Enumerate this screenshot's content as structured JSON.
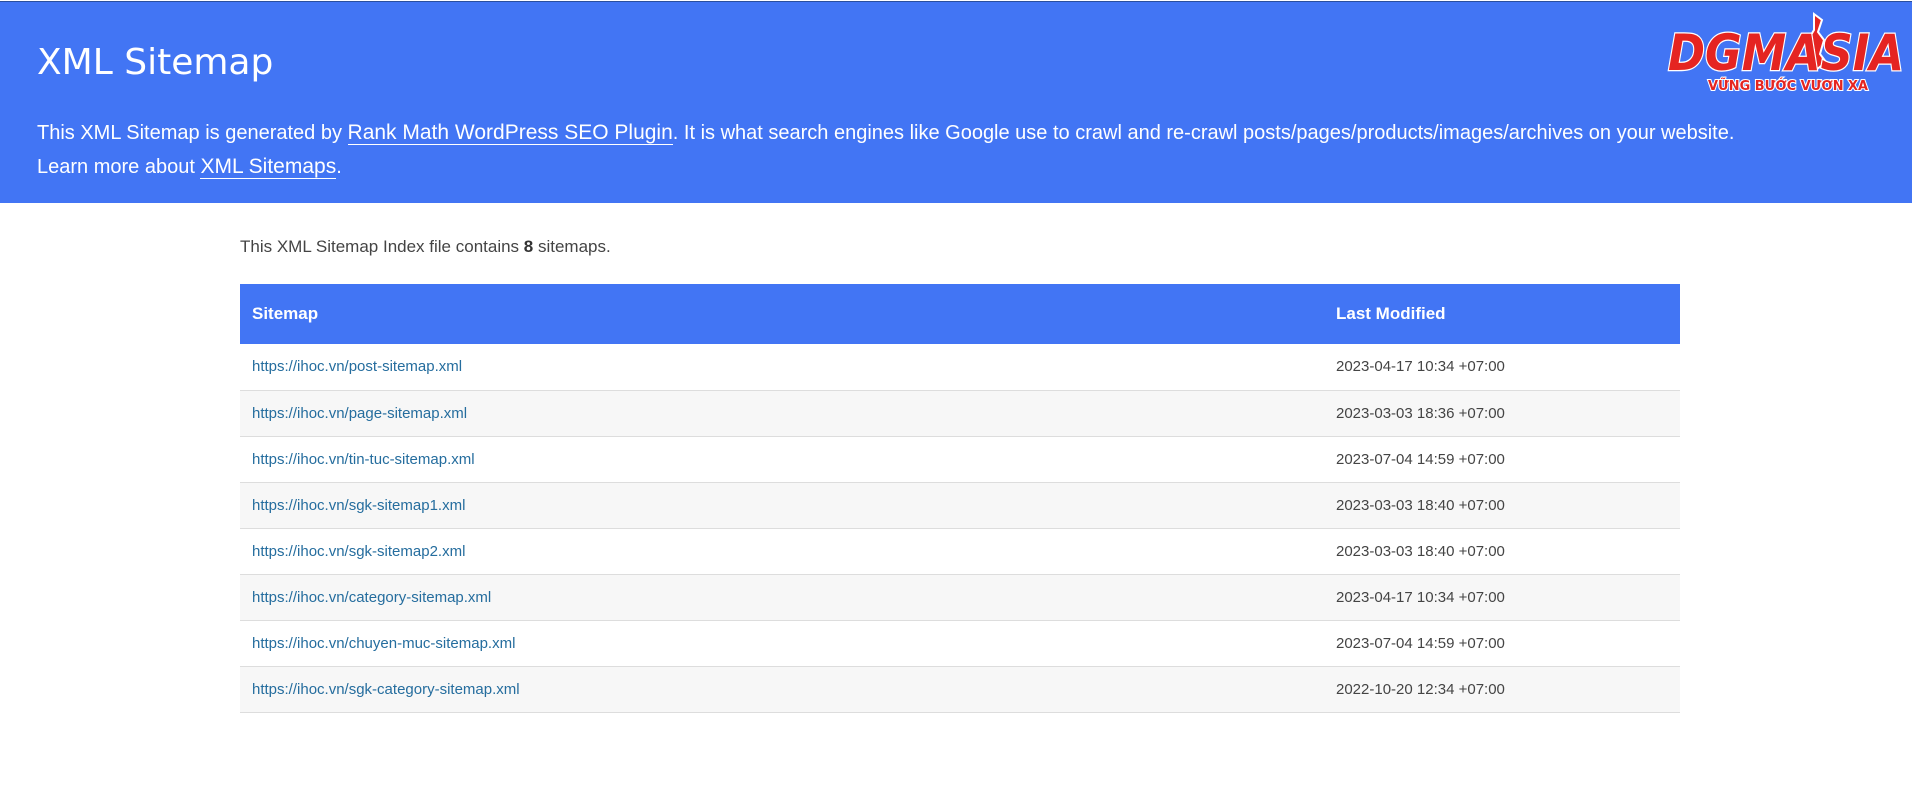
{
  "header": {
    "title": "XML Sitemap",
    "desc_part1": "This XML Sitemap is generated by ",
    "plugin_link": "Rank Math WordPress SEO Plugin",
    "desc_part2": ". It is what search engines like Google use to crawl and re-crawl posts/pages/products/images/archives on your website.",
    "learn_more": "Learn more about ",
    "sitemaps_link": "XML Sitemaps",
    "learn_more_end": ".",
    "brand_color": "#4275f4"
  },
  "logo": {
    "text": "DGMASIA",
    "tagline": "VỮNG BƯỚC VƯƠN XA",
    "colors": {
      "red": "#e52421",
      "blue": "#1d4ea1"
    }
  },
  "summary": {
    "prefix": "This XML Sitemap Index file contains ",
    "count": "8",
    "suffix": " sitemaps."
  },
  "table": {
    "columns": [
      "Sitemap",
      "Last Modified"
    ],
    "rows": [
      {
        "url": "https://ihoc.vn/post-sitemap.xml",
        "modified": "2023-04-17 10:34 +07:00"
      },
      {
        "url": "https://ihoc.vn/page-sitemap.xml",
        "modified": "2023-03-03 18:36 +07:00"
      },
      {
        "url": "https://ihoc.vn/tin-tuc-sitemap.xml",
        "modified": "2023-07-04 14:59 +07:00"
      },
      {
        "url": "https://ihoc.vn/sgk-sitemap1.xml",
        "modified": "2023-03-03 18:40 +07:00"
      },
      {
        "url": "https://ihoc.vn/sgk-sitemap2.xml",
        "modified": "2023-03-03 18:40 +07:00"
      },
      {
        "url": "https://ihoc.vn/category-sitemap.xml",
        "modified": "2023-04-17 10:34 +07:00"
      },
      {
        "url": "https://ihoc.vn/chuyen-muc-sitemap.xml",
        "modified": "2023-07-04 14:59 +07:00"
      },
      {
        "url": "https://ihoc.vn/sgk-category-sitemap.xml",
        "modified": "2022-10-20 12:34 +07:00"
      }
    ]
  }
}
